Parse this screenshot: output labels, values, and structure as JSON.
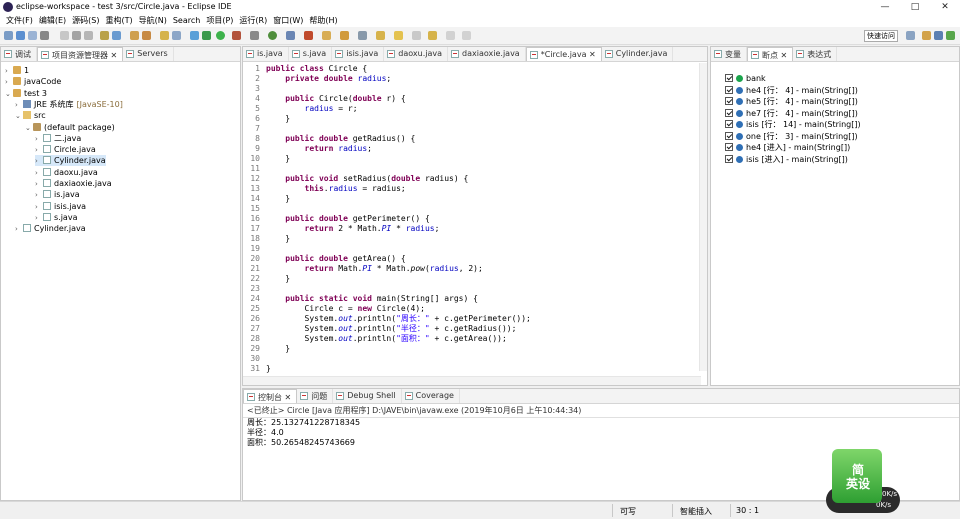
{
  "window": {
    "title": "eclipse-workspace - test 3/src/Circle.java - Eclipse IDE",
    "minimize_glyph": "—",
    "maximize_glyph": "□",
    "close_glyph": "✕"
  },
  "menu": [
    "文件(F)",
    "编辑(E)",
    "源码(S)",
    "重构(T)",
    "导航(N)",
    "Search",
    "项目(P)",
    "运行(R)",
    "窗口(W)",
    "帮助(H)"
  ],
  "toolbar": {
    "quick_access": "快速访问"
  },
  "explorer": {
    "tabs": [
      "调试",
      "项目资源管理器",
      "Servers"
    ],
    "tree": [
      {
        "indent": 0,
        "toggle": ">",
        "icon": "proj",
        "label": "1"
      },
      {
        "indent": 0,
        "toggle": ">",
        "icon": "proj",
        "label": "javaCode"
      },
      {
        "indent": 0,
        "toggle": "v",
        "icon": "proj",
        "label": "test 3"
      },
      {
        "indent": 1,
        "toggle": ">",
        "icon": "lib",
        "label": "JRE 系统库",
        "suffix": "[JavaSE-10]"
      },
      {
        "indent": 1,
        "toggle": "v",
        "icon": "fold",
        "label": "src"
      },
      {
        "indent": 2,
        "toggle": "v",
        "icon": "pkg",
        "label": "(default package)"
      },
      {
        "indent": 3,
        "toggle": ">",
        "icon": "jfile",
        "label": "二.java"
      },
      {
        "indent": 3,
        "toggle": ">",
        "icon": "jfile",
        "label": "Circle.java"
      },
      {
        "indent": 3,
        "toggle": ">",
        "icon": "jfile",
        "label": "Cylinder.java",
        "selected": true
      },
      {
        "indent": 3,
        "toggle": ">",
        "icon": "jfile",
        "label": "daoxu.java"
      },
      {
        "indent": 3,
        "toggle": ">",
        "icon": "jfile",
        "label": "daxiaoxie.java"
      },
      {
        "indent": 3,
        "toggle": ">",
        "icon": "jfile",
        "label": "is.java"
      },
      {
        "indent": 3,
        "toggle": ">",
        "icon": "jfile",
        "label": "isis.java"
      },
      {
        "indent": 3,
        "toggle": ">",
        "icon": "jfile",
        "label": "s.java"
      },
      {
        "indent": 1,
        "toggle": ">",
        "icon": "jfile",
        "label": "Cylinder.java"
      }
    ]
  },
  "editor": {
    "tabs": [
      "is.java",
      "s.java",
      "isis.java",
      "daoxu.java",
      "daxiaoxie.java",
      "*Circle.java",
      "Cylinder.java"
    ],
    "active_tab": 5,
    "lines": [
      {
        "n": "1",
        "code": [
          [
            "kw",
            "public class "
          ],
          [
            "",
            "Circle {"
          ]
        ]
      },
      {
        "n": "2",
        "code": [
          [
            "",
            "    "
          ],
          [
            "kw",
            "private double "
          ],
          [
            "fld",
            "radius"
          ],
          [
            "",
            ";"
          ]
        ]
      },
      {
        "n": "3",
        "code": []
      },
      {
        "n": "4",
        "code": [
          [
            "",
            "    "
          ],
          [
            "kw",
            "public "
          ],
          [
            "",
            "Circle("
          ],
          [
            "kw",
            "double "
          ],
          [
            "",
            "r) {"
          ]
        ]
      },
      {
        "n": "5",
        "code": [
          [
            "",
            "        "
          ],
          [
            "fld",
            "radius"
          ],
          [
            "",
            " = r;"
          ]
        ]
      },
      {
        "n": "6",
        "code": [
          [
            "",
            "    }"
          ]
        ]
      },
      {
        "n": "7",
        "code": []
      },
      {
        "n": "8",
        "code": [
          [
            "",
            "    "
          ],
          [
            "kw",
            "public double "
          ],
          [
            "",
            "getRadius() {"
          ]
        ]
      },
      {
        "n": "9",
        "code": [
          [
            "",
            "        "
          ],
          [
            "kw",
            "return "
          ],
          [
            "fld",
            "radius"
          ],
          [
            "",
            ";"
          ]
        ]
      },
      {
        "n": "10",
        "code": [
          [
            "",
            "    }"
          ]
        ]
      },
      {
        "n": "11",
        "code": []
      },
      {
        "n": "12",
        "code": [
          [
            "",
            "    "
          ],
          [
            "kw",
            "public void "
          ],
          [
            "",
            "setRadius("
          ],
          [
            "kw",
            "double "
          ],
          [
            "",
            "radius) {"
          ]
        ]
      },
      {
        "n": "13",
        "code": [
          [
            "",
            "        "
          ],
          [
            "kw",
            "this"
          ],
          [
            "",
            "."
          ],
          [
            "fld",
            "radius"
          ],
          [
            "",
            " = radius;"
          ]
        ]
      },
      {
        "n": "14",
        "code": [
          [
            "",
            "    }"
          ]
        ]
      },
      {
        "n": "15",
        "code": []
      },
      {
        "n": "16",
        "code": [
          [
            "",
            "    "
          ],
          [
            "kw",
            "public double "
          ],
          [
            "",
            "getPerimeter() {"
          ]
        ]
      },
      {
        "n": "17",
        "code": [
          [
            "",
            "        "
          ],
          [
            "kw",
            "return "
          ],
          [
            "",
            "2 * Math."
          ],
          [
            "fld ital",
            "PI"
          ],
          [
            "",
            " * "
          ],
          [
            "fld",
            "radius"
          ],
          [
            "",
            ";"
          ]
        ]
      },
      {
        "n": "18",
        "code": [
          [
            "",
            "    }"
          ]
        ]
      },
      {
        "n": "19",
        "code": []
      },
      {
        "n": "20",
        "code": [
          [
            "",
            "    "
          ],
          [
            "kw",
            "public double "
          ],
          [
            "",
            "getArea() {"
          ]
        ]
      },
      {
        "n": "21",
        "code": [
          [
            "",
            "        "
          ],
          [
            "kw",
            "return "
          ],
          [
            "",
            "Math."
          ],
          [
            "fld ital",
            "PI"
          ],
          [
            "",
            " * Math."
          ],
          [
            "ital",
            "pow"
          ],
          [
            "",
            "("
          ],
          [
            "fld",
            "radius"
          ],
          [
            "",
            ", 2);"
          ]
        ]
      },
      {
        "n": "22",
        "code": [
          [
            "",
            "    }"
          ]
        ]
      },
      {
        "n": "23",
        "code": []
      },
      {
        "n": "24",
        "code": [
          [
            "",
            "    "
          ],
          [
            "kw",
            "public static void "
          ],
          [
            "",
            "main(String[] args) {"
          ]
        ]
      },
      {
        "n": "25",
        "code": [
          [
            "",
            "        Circle c = "
          ],
          [
            "kw",
            "new "
          ],
          [
            "",
            "Circle(4);"
          ]
        ]
      },
      {
        "n": "26",
        "code": [
          [
            "",
            "        System."
          ],
          [
            "fld ital",
            "out"
          ],
          [
            "",
            ".println("
          ],
          [
            "str",
            "\"周长：\""
          ],
          [
            "",
            " + c.getPerimeter());"
          ]
        ]
      },
      {
        "n": "27",
        "code": [
          [
            "",
            "        System."
          ],
          [
            "fld ital",
            "out"
          ],
          [
            "",
            ".println("
          ],
          [
            "str",
            "\"半径：\""
          ],
          [
            "",
            " + c.getRadius());"
          ]
        ]
      },
      {
        "n": "28",
        "code": [
          [
            "",
            "        System."
          ],
          [
            "fld ital",
            "out"
          ],
          [
            "",
            ".println("
          ],
          [
            "str",
            "\"面积：\""
          ],
          [
            "",
            " + c.getArea());"
          ]
        ]
      },
      {
        "n": "29",
        "code": [
          [
            "",
            "    }"
          ]
        ]
      },
      {
        "n": "30",
        "code": []
      },
      {
        "n": "31",
        "code": [
          [
            "",
            "}"
          ]
        ]
      }
    ]
  },
  "breakpoints": {
    "tabs": [
      "变量",
      "断点",
      "表达式"
    ],
    "items": [
      {
        "label": "bank",
        "green": true
      },
      {
        "label": "he4 [行： 4] - main(String[])"
      },
      {
        "label": "he5 [行： 4] - main(String[])"
      },
      {
        "label": "he7 [行： 4] - main(String[])"
      },
      {
        "label": "isis [行： 14] - main(String[])"
      },
      {
        "label": "one [行： 3] - main(String[])"
      },
      {
        "label": "he4 [进入] - main(String[])"
      },
      {
        "label": "isis [进入] - main(String[])"
      }
    ]
  },
  "console": {
    "tabs": [
      "控制台",
      "问题",
      "Debug Shell",
      "Coverage"
    ],
    "header": "<已终止> Circle [Java 应用程序] D:\\JAVE\\bin\\javaw.exe  (2019年10月6日 上午10:44:34)",
    "output": [
      "周长：25.132741228718345",
      "半径：4.0",
      "面积：50.26548245743669"
    ]
  },
  "status": {
    "writable": "可写",
    "insert_mode": "智能插入",
    "position": "30 : 1"
  },
  "widget": {
    "text": "简\n英设",
    "speed_top": "0K/s",
    "speed_mid": "0%",
    "speed_bottom": "0K/s"
  }
}
